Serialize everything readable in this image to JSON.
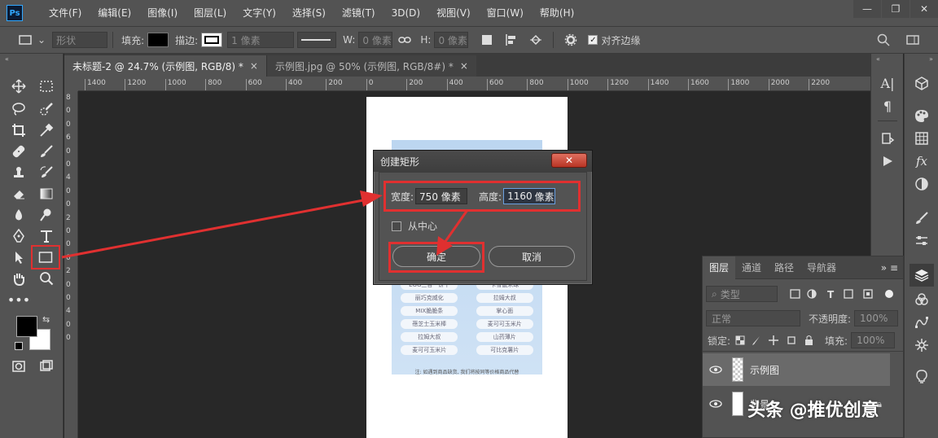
{
  "app": {
    "logo": "Ps"
  },
  "menu": [
    "文件(F)",
    "编辑(E)",
    "图像(I)",
    "图层(L)",
    "文字(Y)",
    "选择(S)",
    "滤镜(T)",
    "3D(D)",
    "视图(V)",
    "窗口(W)",
    "帮助(H)"
  ],
  "window_controls": {
    "minimize": "—",
    "restore": "❐",
    "close": "✕"
  },
  "options": {
    "mode": "形状",
    "fill_label": "填充:",
    "stroke_label": "描边:",
    "stroke_width": "1 像素",
    "w_label": "W:",
    "w_value": "0 像素",
    "h_label": "H:",
    "h_value": "0 像素",
    "align_edges": "对齐边缘"
  },
  "tabs": [
    {
      "label": "未标题-2 @ 24.7% (示例图, RGB/8) *",
      "close": "×"
    },
    {
      "label": "示例图.jpg @ 50% (示例图, RGB/8#) *",
      "close": "×"
    }
  ],
  "ruler_h": [
    "1400",
    "1200",
    "1000",
    "800",
    "600",
    "400",
    "200",
    "0",
    "200",
    "400",
    "600",
    "800",
    "1000",
    "1200",
    "1400",
    "1600",
    "1800",
    "2000",
    "2200"
  ],
  "ruler_v": [
    "8",
    "0",
    "0",
    "6",
    "0",
    "0",
    "4",
    "0",
    "0",
    "2",
    "0",
    "0",
    "0",
    "2",
    "0",
    "0",
    "4",
    "0",
    "0"
  ],
  "doc_menu": [
    [
      "EGG三合一饼干",
      "卡雪鼠米球"
    ],
    [
      "丽巧克威化",
      "拉姆大叔"
    ],
    [
      "MIX脆脆条",
      "掌心面"
    ],
    [
      "蓓芝士玉米棒",
      "麦可可玉米片"
    ],
    [
      "拉姆大叔",
      "山药薄片"
    ],
    [
      "麦可可玉米片",
      "可比克薯片"
    ]
  ],
  "doc_footer": "注: 如遇到商品缺货, 我们将按同等价格商品代替",
  "dialog": {
    "title": "创建矩形",
    "close": "✕",
    "width_label": "宽度:",
    "width_value": "750 像素",
    "height_label": "高度:",
    "height_value": "1160",
    "height_unit": "像素",
    "from_center": "从中心",
    "ok": "确定",
    "cancel": "取消"
  },
  "layers_panel": {
    "tabs": [
      "图层",
      "通道",
      "路径",
      "导航器"
    ],
    "filter_placeholder": "类型",
    "blend_mode": "正常",
    "opacity_label": "不透明度:",
    "opacity_value": "100%",
    "lock_label": "锁定:",
    "fill_label": "填充:",
    "fill_value": "100%",
    "layers": [
      {
        "name": "示例图"
      },
      {
        "name": "背景"
      }
    ]
  },
  "right_col_a": [
    "A|",
    "¶"
  ],
  "watermark": "头条 @推优创意",
  "colors": {
    "highlight": "#e03030",
    "ui_bg": "#535353",
    "canvas_bg": "#282828"
  }
}
